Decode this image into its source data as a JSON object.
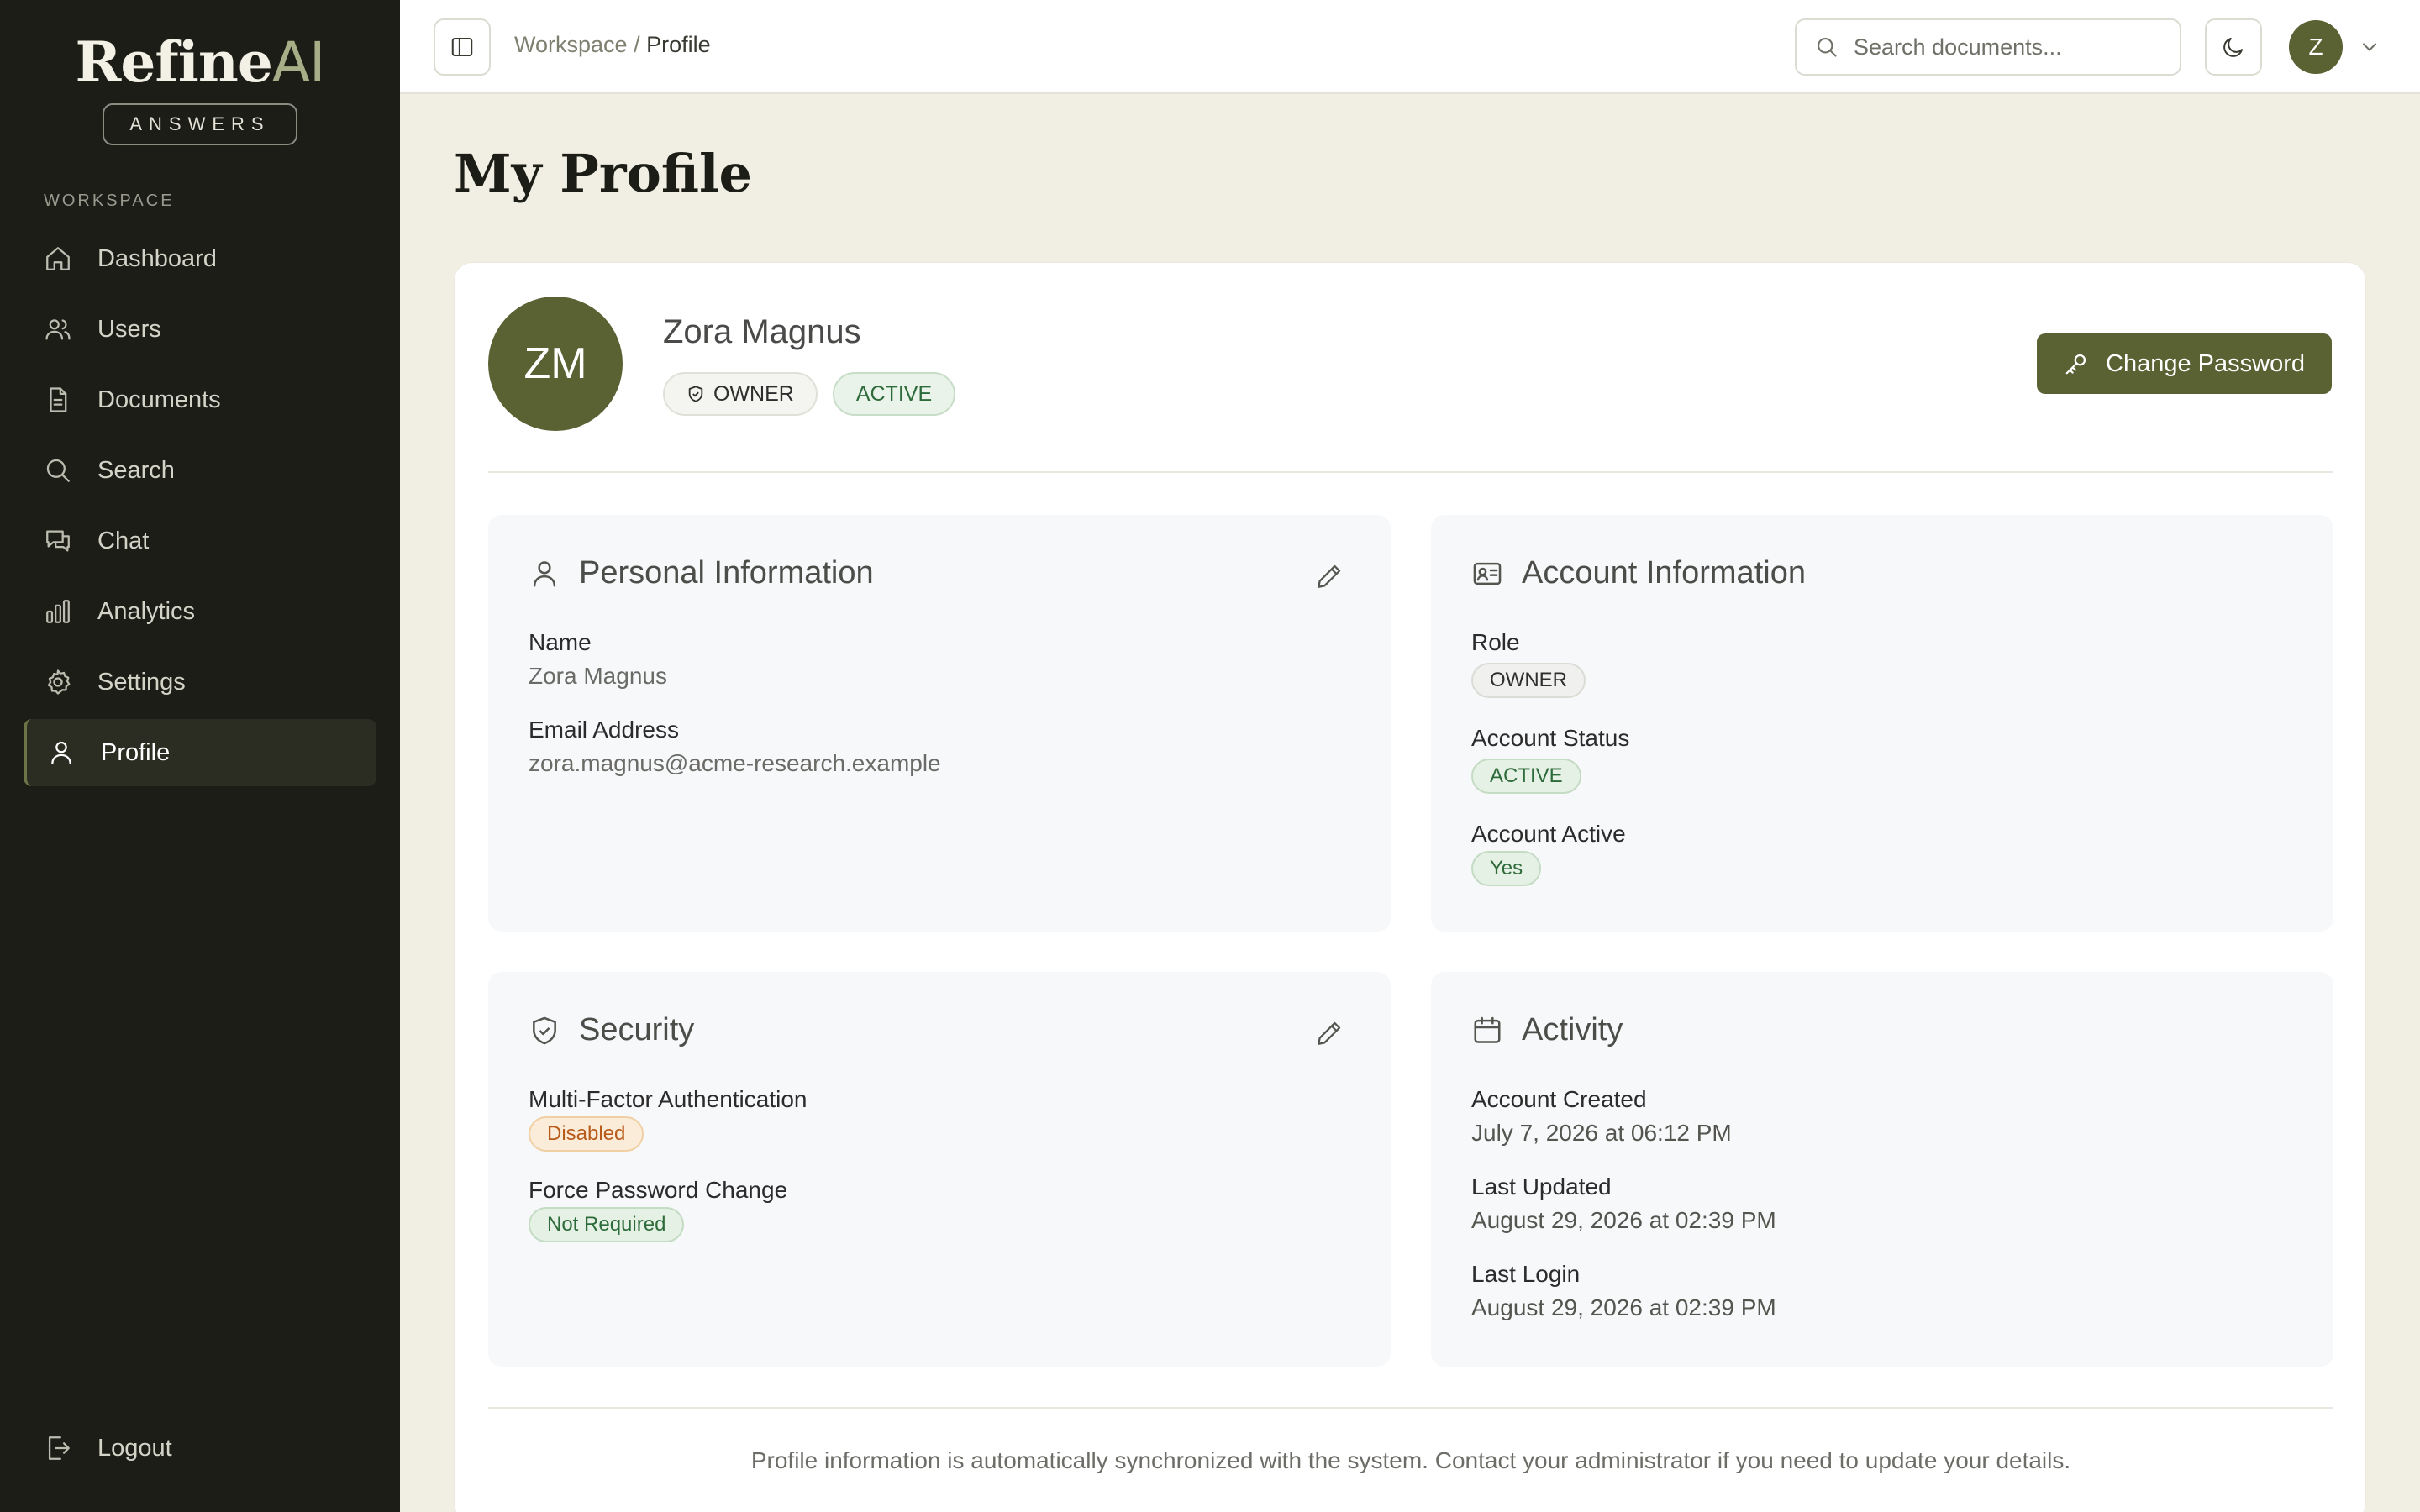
{
  "brand": {
    "title_main": "Refine",
    "title_accent": "AI",
    "subtitle": "ANSWERS"
  },
  "sidebar": {
    "section_label": "WORKSPACE",
    "items": [
      {
        "label": "Dashboard",
        "icon": "home-icon"
      },
      {
        "label": "Users",
        "icon": "users-icon"
      },
      {
        "label": "Documents",
        "icon": "document-icon"
      },
      {
        "label": "Search",
        "icon": "search-icon"
      },
      {
        "label": "Chat",
        "icon": "chat-icon"
      },
      {
        "label": "Analytics",
        "icon": "bar-chart-icon"
      },
      {
        "label": "Settings",
        "icon": "gear-icon"
      },
      {
        "label": "Profile",
        "icon": "user-icon",
        "active": true
      }
    ],
    "logout_label": "Logout"
  },
  "topbar": {
    "breadcrumb_parent": "Workspace",
    "breadcrumb_sep": "/",
    "breadcrumb_current": "Profile",
    "search_placeholder": "Search documents...",
    "user_initial": "Z"
  },
  "page": {
    "title": "My Profile"
  },
  "profile": {
    "initials": "ZM",
    "name": "Zora Magnus",
    "role_badge": "OWNER",
    "status_badge": "ACTIVE",
    "change_password_label": "Change Password"
  },
  "personal": {
    "title": "Personal Information",
    "name_label": "Name",
    "name_value": "Zora Magnus",
    "email_label": "Email Address",
    "email_value": "zora.magnus@acme-research.example"
  },
  "account": {
    "title": "Account Information",
    "role_label": "Role",
    "role_value": "OWNER",
    "status_label": "Account Status",
    "status_value": "ACTIVE",
    "active_label": "Account Active",
    "active_value": "Yes"
  },
  "security": {
    "title": "Security",
    "mfa_label": "Multi-Factor Authentication",
    "mfa_value": "Disabled",
    "force_label": "Force Password Change",
    "force_value": "Not Required"
  },
  "activity": {
    "title": "Activity",
    "created_label": "Account Created",
    "created_value": "July 7, 2026 at 06:12 PM",
    "updated_label": "Last Updated",
    "updated_value": "August 29, 2026 at 02:39 PM",
    "login_label": "Last Login",
    "login_value": "August 29, 2026 at 02:39 PM"
  },
  "footer": {
    "note": "Profile information is automatically synchronized with the system. Contact your administrator if you need to update your details."
  },
  "colors": {
    "accent": "#5a6133",
    "sidebar_bg": "#1c1d16",
    "page_bg": "#f1efe3"
  }
}
